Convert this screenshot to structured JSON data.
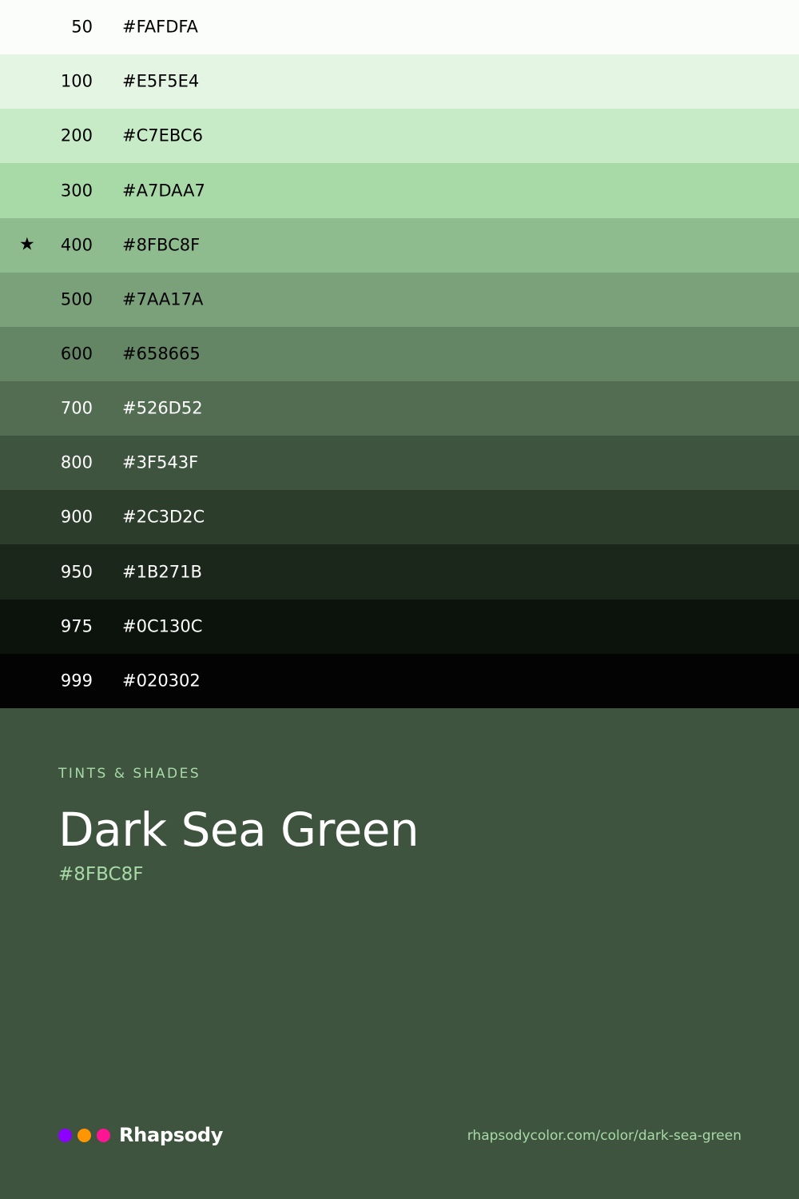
{
  "swatches": [
    {
      "step": "50",
      "hex": "#FAFDFA",
      "text_color": "#000000",
      "base": false
    },
    {
      "step": "100",
      "hex": "#E5F5E4",
      "text_color": "#000000",
      "base": false
    },
    {
      "step": "200",
      "hex": "#C7EBC6",
      "text_color": "#000000",
      "base": false
    },
    {
      "step": "300",
      "hex": "#A7DAA7",
      "text_color": "#000000",
      "base": false
    },
    {
      "step": "400",
      "hex": "#8FBC8F",
      "text_color": "#000000",
      "base": true
    },
    {
      "step": "500",
      "hex": "#7AA17A",
      "text_color": "#000000",
      "base": false
    },
    {
      "step": "600",
      "hex": "#658665",
      "text_color": "#000000",
      "base": false
    },
    {
      "step": "700",
      "hex": "#526D52",
      "text_color": "#ffffff",
      "base": false
    },
    {
      "step": "800",
      "hex": "#3F543F",
      "text_color": "#ffffff",
      "base": false
    },
    {
      "step": "900",
      "hex": "#2C3D2C",
      "text_color": "#ffffff",
      "base": false
    },
    {
      "step": "950",
      "hex": "#1B271B",
      "text_color": "#ffffff",
      "base": false
    },
    {
      "step": "975",
      "hex": "#0C130C",
      "text_color": "#ffffff",
      "base": false
    },
    {
      "step": "999",
      "hex": "#020302",
      "text_color": "#ffffff",
      "base": false
    }
  ],
  "base_marker_icon": "star-icon",
  "base_marker_glyph": "★",
  "info": {
    "eyebrow": "TINTS & SHADES",
    "title": "Dark Sea Green",
    "hex": "#8FBC8F"
  },
  "colors": {
    "background": "#3F543F",
    "accent": "#A7DAA7",
    "heading": "#ffffff"
  },
  "footer": {
    "brand": "Rhapsody",
    "brand_dots": [
      {
        "icon": "purple-dot-icon",
        "color": "#8B00FF"
      },
      {
        "icon": "orange-dot-icon",
        "color": "#FF9500"
      },
      {
        "icon": "pink-dot-icon",
        "color": "#FF1493"
      }
    ],
    "url": "rhapsodycolor.com/color/dark-sea-green"
  }
}
